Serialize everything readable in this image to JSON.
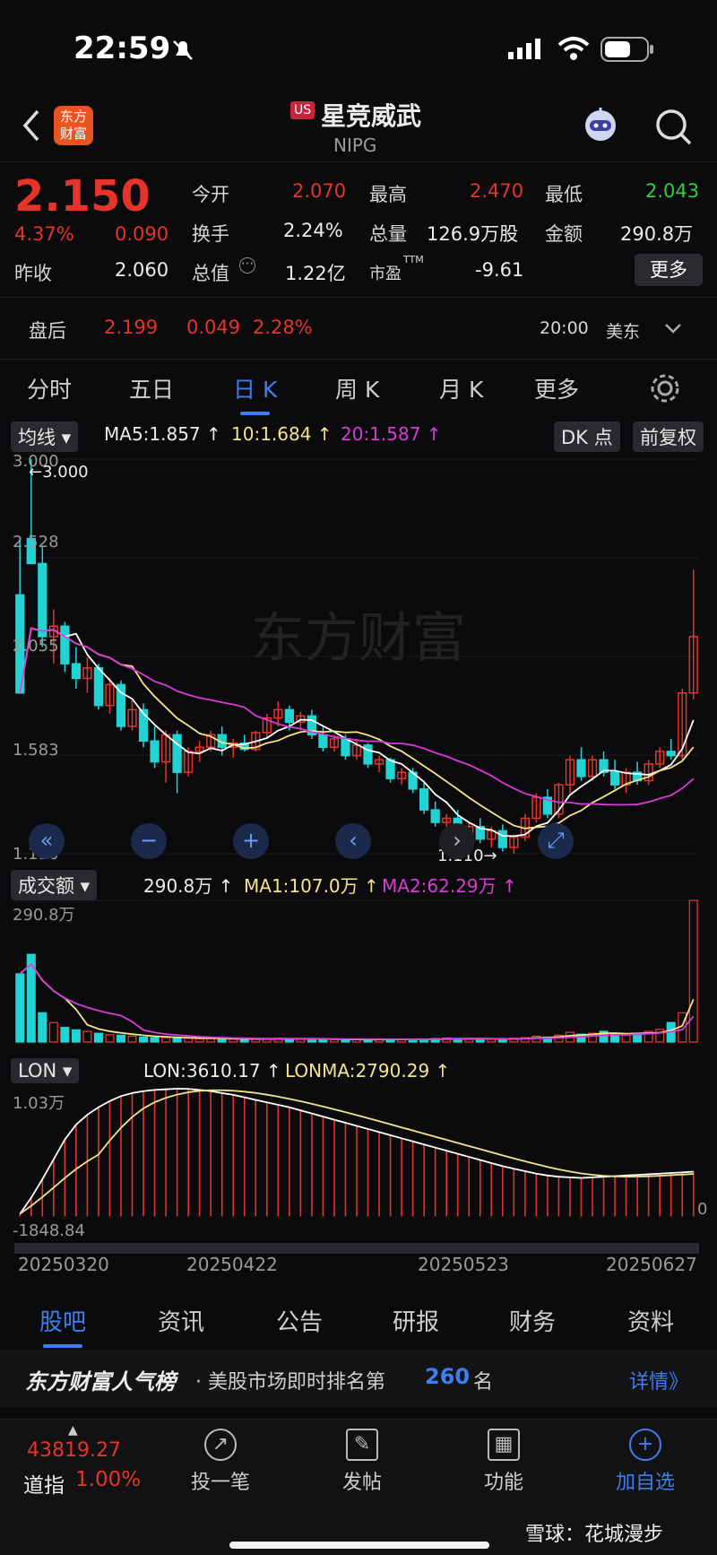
{
  "status_bar": {
    "time": "22:59"
  },
  "header": {
    "logo_text_1": "东方",
    "logo_text_2": "财富",
    "market_badge": "US",
    "title": "星竞威武",
    "ticker": "NIPG"
  },
  "quote": {
    "price": "2.150",
    "change_pct": "4.37%",
    "change": "0.090",
    "prev_close_label": "昨收",
    "prev_close": "2.060",
    "open_label": "今开",
    "open": "2.070",
    "high_label": "最高",
    "high": "2.470",
    "low_label": "最低",
    "low": "2.043",
    "turnover_label": "换手",
    "turnover": "2.24%",
    "volume_label": "总量",
    "volume": "126.9万股",
    "amount_label": "金额",
    "amount": "290.8万",
    "mktcap_label": "总值",
    "mktcap": "1.22亿",
    "pe_label": "市盈",
    "pe_sup": "TTM",
    "pe": "-9.61",
    "more_button": "更多",
    "after_label": "盘后",
    "after_price": "2.199",
    "after_change": "0.049",
    "after_pct": "2.28%",
    "after_time": "20:00",
    "after_zone": "美东"
  },
  "tabs": [
    "分时",
    "五日",
    "日 K",
    "周 K",
    "月 K",
    "更多"
  ],
  "indicators": {
    "ma_selector": "均线",
    "ma5": "MA5:1.857 ↑",
    "ma10": "10:1.684 ↑",
    "ma20": "20:1.587 ↑",
    "dk_button": "DK 点",
    "adjust_button": "前复权",
    "price_axis": [
      "3.000",
      "2.528",
      "2.055",
      "1.583",
      "1.110"
    ],
    "high_marker": "←3.000",
    "low_marker": "1.110→",
    "watermark": "东方财富",
    "vol_selector": "成交额",
    "vol_value": "290.8万 ↑",
    "vol_ma1": "MA1:107.0万 ↑",
    "vol_ma2": "MA2:62.29万 ↑",
    "vol_axis_top": "290.8万",
    "lon_selector": "LON",
    "lon_value": "LON:3610.17 ↑",
    "lonma_value": "LONMA:2790.29 ↑",
    "lon_axis_top": "1.03万",
    "lon_axis_bottom": "-1848.84",
    "lon_axis_zero": "0",
    "dates": [
      "20250320",
      "20250422",
      "20250523",
      "20250627"
    ]
  },
  "colors": {
    "up": "#e5342b",
    "down": "#22d3d3",
    "ma5": "#ffffff",
    "ma10": "#f4e48a",
    "ma20": "#d83bd6",
    "accent": "#3d7ef0"
  },
  "chart_data": {
    "type": "candlestick",
    "ylim": [
      1.11,
      3.0
    ],
    "candles": [
      [
        2.35,
        2.62,
        2.3,
        1.88
      ],
      [
        2.62,
        3.0,
        2.58,
        2.5
      ],
      [
        2.5,
        2.58,
        2.1,
        2.15
      ],
      [
        2.15,
        2.28,
        2.02,
        2.2
      ],
      [
        2.2,
        2.22,
        1.98,
        2.02
      ],
      [
        2.02,
        2.1,
        1.9,
        1.95
      ],
      [
        1.95,
        2.05,
        1.88,
        2.0
      ],
      [
        2.0,
        2.02,
        1.8,
        1.82
      ],
      [
        1.82,
        1.95,
        1.78,
        1.92
      ],
      [
        1.92,
        1.94,
        1.7,
        1.72
      ],
      [
        1.72,
        1.85,
        1.7,
        1.8
      ],
      [
        1.8,
        1.83,
        1.62,
        1.65
      ],
      [
        1.65,
        1.72,
        1.52,
        1.55
      ],
      [
        1.55,
        1.7,
        1.45,
        1.68
      ],
      [
        1.68,
        1.7,
        1.4,
        1.5
      ],
      [
        1.5,
        1.62,
        1.48,
        1.6
      ],
      [
        1.6,
        1.65,
        1.55,
        1.62
      ],
      [
        1.62,
        1.7,
        1.6,
        1.68
      ],
      [
        1.68,
        1.72,
        1.58,
        1.62
      ],
      [
        1.62,
        1.66,
        1.57,
        1.64
      ],
      [
        1.64,
        1.68,
        1.6,
        1.61
      ],
      [
        1.61,
        1.7,
        1.6,
        1.69
      ],
      [
        1.69,
        1.78,
        1.66,
        1.76
      ],
      [
        1.76,
        1.84,
        1.72,
        1.8
      ],
      [
        1.8,
        1.82,
        1.7,
        1.74
      ],
      [
        1.74,
        1.79,
        1.7,
        1.77
      ],
      [
        1.77,
        1.8,
        1.66,
        1.68
      ],
      [
        1.68,
        1.72,
        1.6,
        1.62
      ],
      [
        1.62,
        1.68,
        1.6,
        1.66
      ],
      [
        1.66,
        1.68,
        1.56,
        1.58
      ],
      [
        1.58,
        1.66,
        1.56,
        1.63
      ],
      [
        1.63,
        1.64,
        1.52,
        1.54
      ],
      [
        1.54,
        1.58,
        1.5,
        1.56
      ],
      [
        1.56,
        1.57,
        1.45,
        1.47
      ],
      [
        1.47,
        1.52,
        1.44,
        1.5
      ],
      [
        1.5,
        1.52,
        1.4,
        1.42
      ],
      [
        1.42,
        1.46,
        1.3,
        1.32
      ],
      [
        1.32,
        1.36,
        1.24,
        1.26
      ],
      [
        1.26,
        1.3,
        1.2,
        1.28
      ],
      [
        1.28,
        1.32,
        1.18,
        1.2
      ],
      [
        1.2,
        1.26,
        1.15,
        1.24
      ],
      [
        1.24,
        1.28,
        1.16,
        1.18
      ],
      [
        1.18,
        1.24,
        1.14,
        1.22
      ],
      [
        1.22,
        1.25,
        1.12,
        1.14
      ],
      [
        1.14,
        1.2,
        1.11,
        1.19
      ],
      [
        1.19,
        1.3,
        1.17,
        1.28
      ],
      [
        1.28,
        1.4,
        1.26,
        1.38
      ],
      [
        1.38,
        1.42,
        1.28,
        1.3
      ],
      [
        1.3,
        1.45,
        1.28,
        1.44
      ],
      [
        1.44,
        1.58,
        1.4,
        1.56
      ],
      [
        1.56,
        1.62,
        1.46,
        1.48
      ],
      [
        1.48,
        1.58,
        1.46,
        1.56
      ],
      [
        1.56,
        1.6,
        1.48,
        1.5
      ],
      [
        1.5,
        1.56,
        1.42,
        1.44
      ],
      [
        1.44,
        1.52,
        1.4,
        1.5
      ],
      [
        1.5,
        1.55,
        1.44,
        1.46
      ],
      [
        1.46,
        1.56,
        1.44,
        1.54
      ],
      [
        1.54,
        1.62,
        1.52,
        1.6
      ],
      [
        1.6,
        1.66,
        1.56,
        1.58
      ],
      [
        1.58,
        1.9,
        1.56,
        1.88
      ],
      [
        1.88,
        2.47,
        1.85,
        2.15
      ]
    ],
    "volume_range": [
      0,
      290.8
    ],
    "volume": [
      140,
      180,
      60,
      40,
      30,
      25,
      22,
      18,
      15,
      14,
      12,
      10,
      9,
      9,
      8,
      8,
      7,
      7,
      7,
      6,
      6,
      6,
      7,
      8,
      7,
      6,
      6,
      6,
      5,
      5,
      5,
      5,
      6,
      6,
      5,
      5,
      6,
      7,
      8,
      7,
      6,
      6,
      6,
      7,
      8,
      9,
      12,
      10,
      14,
      20,
      16,
      18,
      22,
      16,
      14,
      18,
      22,
      26,
      40,
      60,
      290.8
    ],
    "lon_range": [
      -1848.84,
      10300
    ],
    "lon": [
      200,
      1500,
      3000,
      4600,
      6200,
      7400,
      8200,
      8800,
      9300,
      9700,
      9950,
      10100,
      10200,
      10250,
      10300,
      10280,
      10200,
      10100,
      9950,
      9800,
      9600,
      9400,
      9200,
      9000,
      8800,
      8550,
      8300,
      8050,
      7800,
      7550,
      7300,
      7050,
      6800,
      6550,
      6300,
      6050,
      5800,
      5550,
      5300,
      5050,
      4800,
      4550,
      4300,
      4050,
      3850,
      3650,
      3450,
      3300,
      3200,
      3150,
      3100,
      3150,
      3200,
      3250,
      3300,
      3350,
      3400,
      3450,
      3500,
      3550,
      3610.17
    ]
  },
  "bottom_tabs": [
    "股吧",
    "资讯",
    "公告",
    "研报",
    "财务",
    "资料"
  ],
  "ranking": {
    "brand": "东方财富人气榜",
    "text": "· 美股市场即时排名第",
    "rank": "260",
    "suffix": "名",
    "link": "详情》"
  },
  "dock": {
    "index_value": "43819.27",
    "index_name": "道指",
    "index_pct": "1.00%",
    "items": [
      "投一笔",
      "发帖",
      "功能",
      "加自选"
    ]
  },
  "footer_credit": "雪球：花城漫步"
}
